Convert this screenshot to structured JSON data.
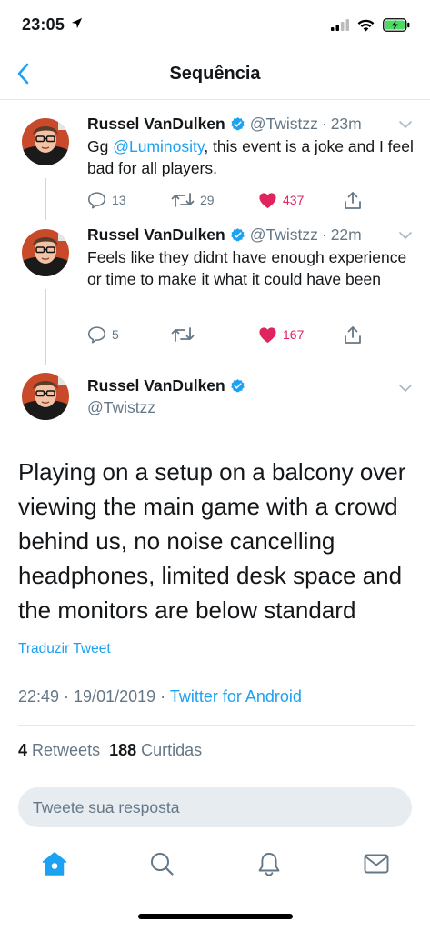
{
  "status_bar": {
    "time": "23:05"
  },
  "header": {
    "title": "Sequência"
  },
  "colors": {
    "accent": "#1da1f2",
    "like": "#e0245e",
    "muted": "#657786"
  },
  "tweets": [
    {
      "name": "Russel VanDulken",
      "handle": "@Twistzz",
      "sep": "·",
      "time": "23m",
      "text_prefix": "Gg ",
      "mention": "@Luminosity",
      "text_suffix": ", this event is a joke and I feel bad for all players.",
      "replies": "13",
      "retweets": "29",
      "likes": "437"
    },
    {
      "name": "Russel VanDulken",
      "handle": "@Twistzz",
      "sep": "·",
      "time": "22m",
      "text": "Feels like they didnt have enough experience or time to make it what it could have been",
      "replies": "5",
      "likes": "167"
    }
  ],
  "main_tweet": {
    "name": "Russel VanDulken",
    "handle": "@Twistzz",
    "text": "Playing on a setup on a balcony over viewing the main game with a crowd behind us, no noise cancelling headphones, limited desk space and the monitors are below standard",
    "translate": "Traduzir Tweet",
    "timestamp": "22:49 · 19/01/2019 · ",
    "source": "Twitter for Android",
    "retweets_count": "4",
    "retweets_label": "Retweets",
    "likes_count": "188",
    "likes_label": "Curtidas"
  },
  "reply": {
    "placeholder": "Tweete sua resposta"
  },
  "tabs": [
    "home-icon",
    "search-icon",
    "notifications-icon",
    "messages-icon"
  ]
}
